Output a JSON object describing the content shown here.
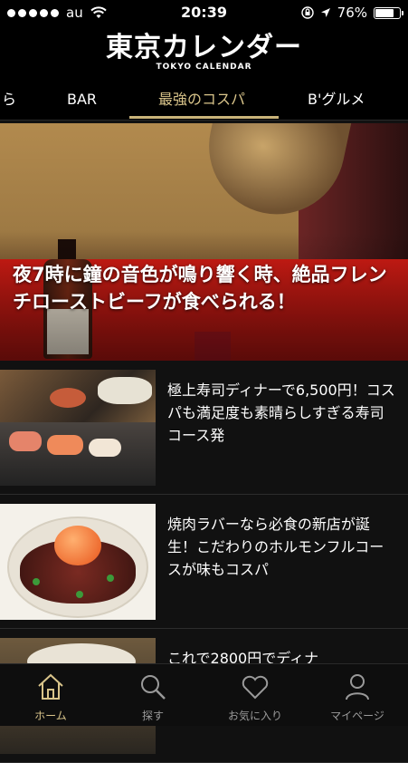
{
  "status_bar": {
    "carrier": "au",
    "time": "20:39",
    "battery": "76%",
    "battery_level": 0.76,
    "signal_bars": 5
  },
  "header": {
    "logo": "東京カレンダー",
    "logo_sub": "TOKYO CALENDAR"
  },
  "tabs": [
    {
      "label": "ら"
    },
    {
      "label": "BAR"
    },
    {
      "label": "最強のコスパ",
      "active": true
    },
    {
      "label": "B'グルメ"
    }
  ],
  "hero": {
    "title": "夜7時に鐘の音色が鳴り響く時、絶品フレンチローストビーフが食べられる！"
  },
  "articles": [
    {
      "title": "極上寿司ディナーで6,500円！コスパも満足度も素晴らしすぎる寿司コース発"
    },
    {
      "title": "焼肉ラバーなら必食の新店が誕生！こだわりのホルモンフルコースが味もコスパ"
    },
    {
      "title": "これで2800円でディナ"
    }
  ],
  "tab_bar": [
    {
      "label": "ホーム",
      "icon": "home-icon",
      "active": true
    },
    {
      "label": "探す",
      "icon": "search-icon"
    },
    {
      "label": "お気に入り",
      "icon": "heart-icon"
    },
    {
      "label": "マイページ",
      "icon": "person-icon"
    }
  ],
  "colors": {
    "accent": "#d9c48a",
    "background": "#111111",
    "text": "#ffffff"
  }
}
